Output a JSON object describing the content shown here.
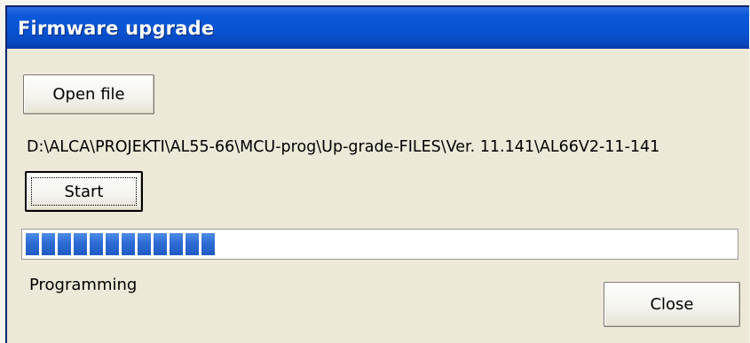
{
  "window": {
    "title": "Firmware upgrade"
  },
  "buttons": {
    "open_file_label": "Open file",
    "start_label": "Start",
    "close_label": "Close"
  },
  "file_path": "D:\\ALCA\\PROJEKTI\\AL55-66\\MCU-prog\\Up-grade-FILES\\Ver. 11.141\\AL66V2-11-141",
  "progress": {
    "percent": 27,
    "block_count": 12,
    "color": "#2d6bd3"
  },
  "status_text": "Programming",
  "colors": {
    "titlebar": "#0854d2",
    "window_background": "#ece9d8"
  }
}
